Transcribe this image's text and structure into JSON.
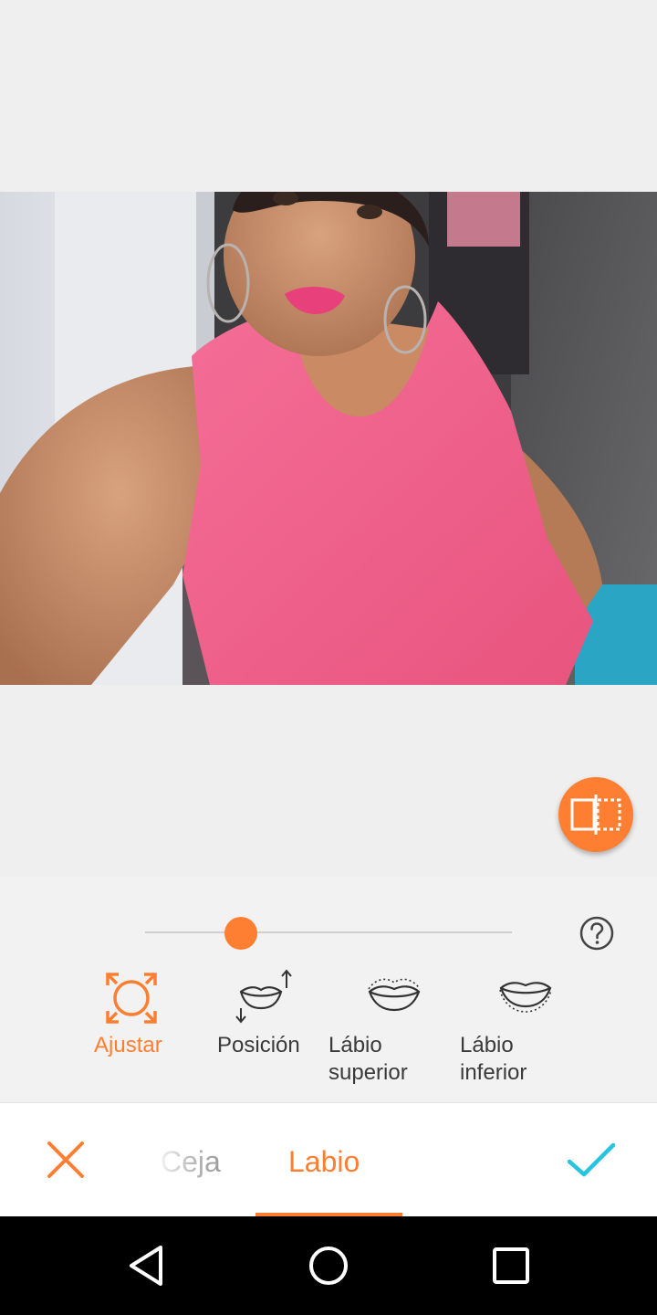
{
  "colors": {
    "accent": "#ff7f32",
    "confirm": "#27c4e0",
    "text": "#3a3a3a",
    "inactive_tab": "#bdbdbd"
  },
  "editor": {
    "compare_icon": "compare-split-icon"
  },
  "adjust": {
    "slider_value": 0.26,
    "help_icon": "help-icon"
  },
  "tools": [
    {
      "label": "Ajustar",
      "icon": "resize-frame-icon",
      "active": true
    },
    {
      "label": "Posición",
      "icon": "lips-position-icon",
      "active": false
    },
    {
      "label": "Lábio superior",
      "icon": "upper-lip-icon",
      "active": false
    },
    {
      "label": "Lábio inferior",
      "icon": "lower-lip-icon",
      "active": false
    }
  ],
  "bottom_bar": {
    "cancel_icon": "close-icon",
    "confirm_icon": "check-icon",
    "tabs": [
      {
        "label": "Ceja",
        "active": false
      },
      {
        "label": "Labio",
        "active": true
      }
    ]
  },
  "nav": [
    "back-icon",
    "home-icon",
    "recents-icon"
  ]
}
